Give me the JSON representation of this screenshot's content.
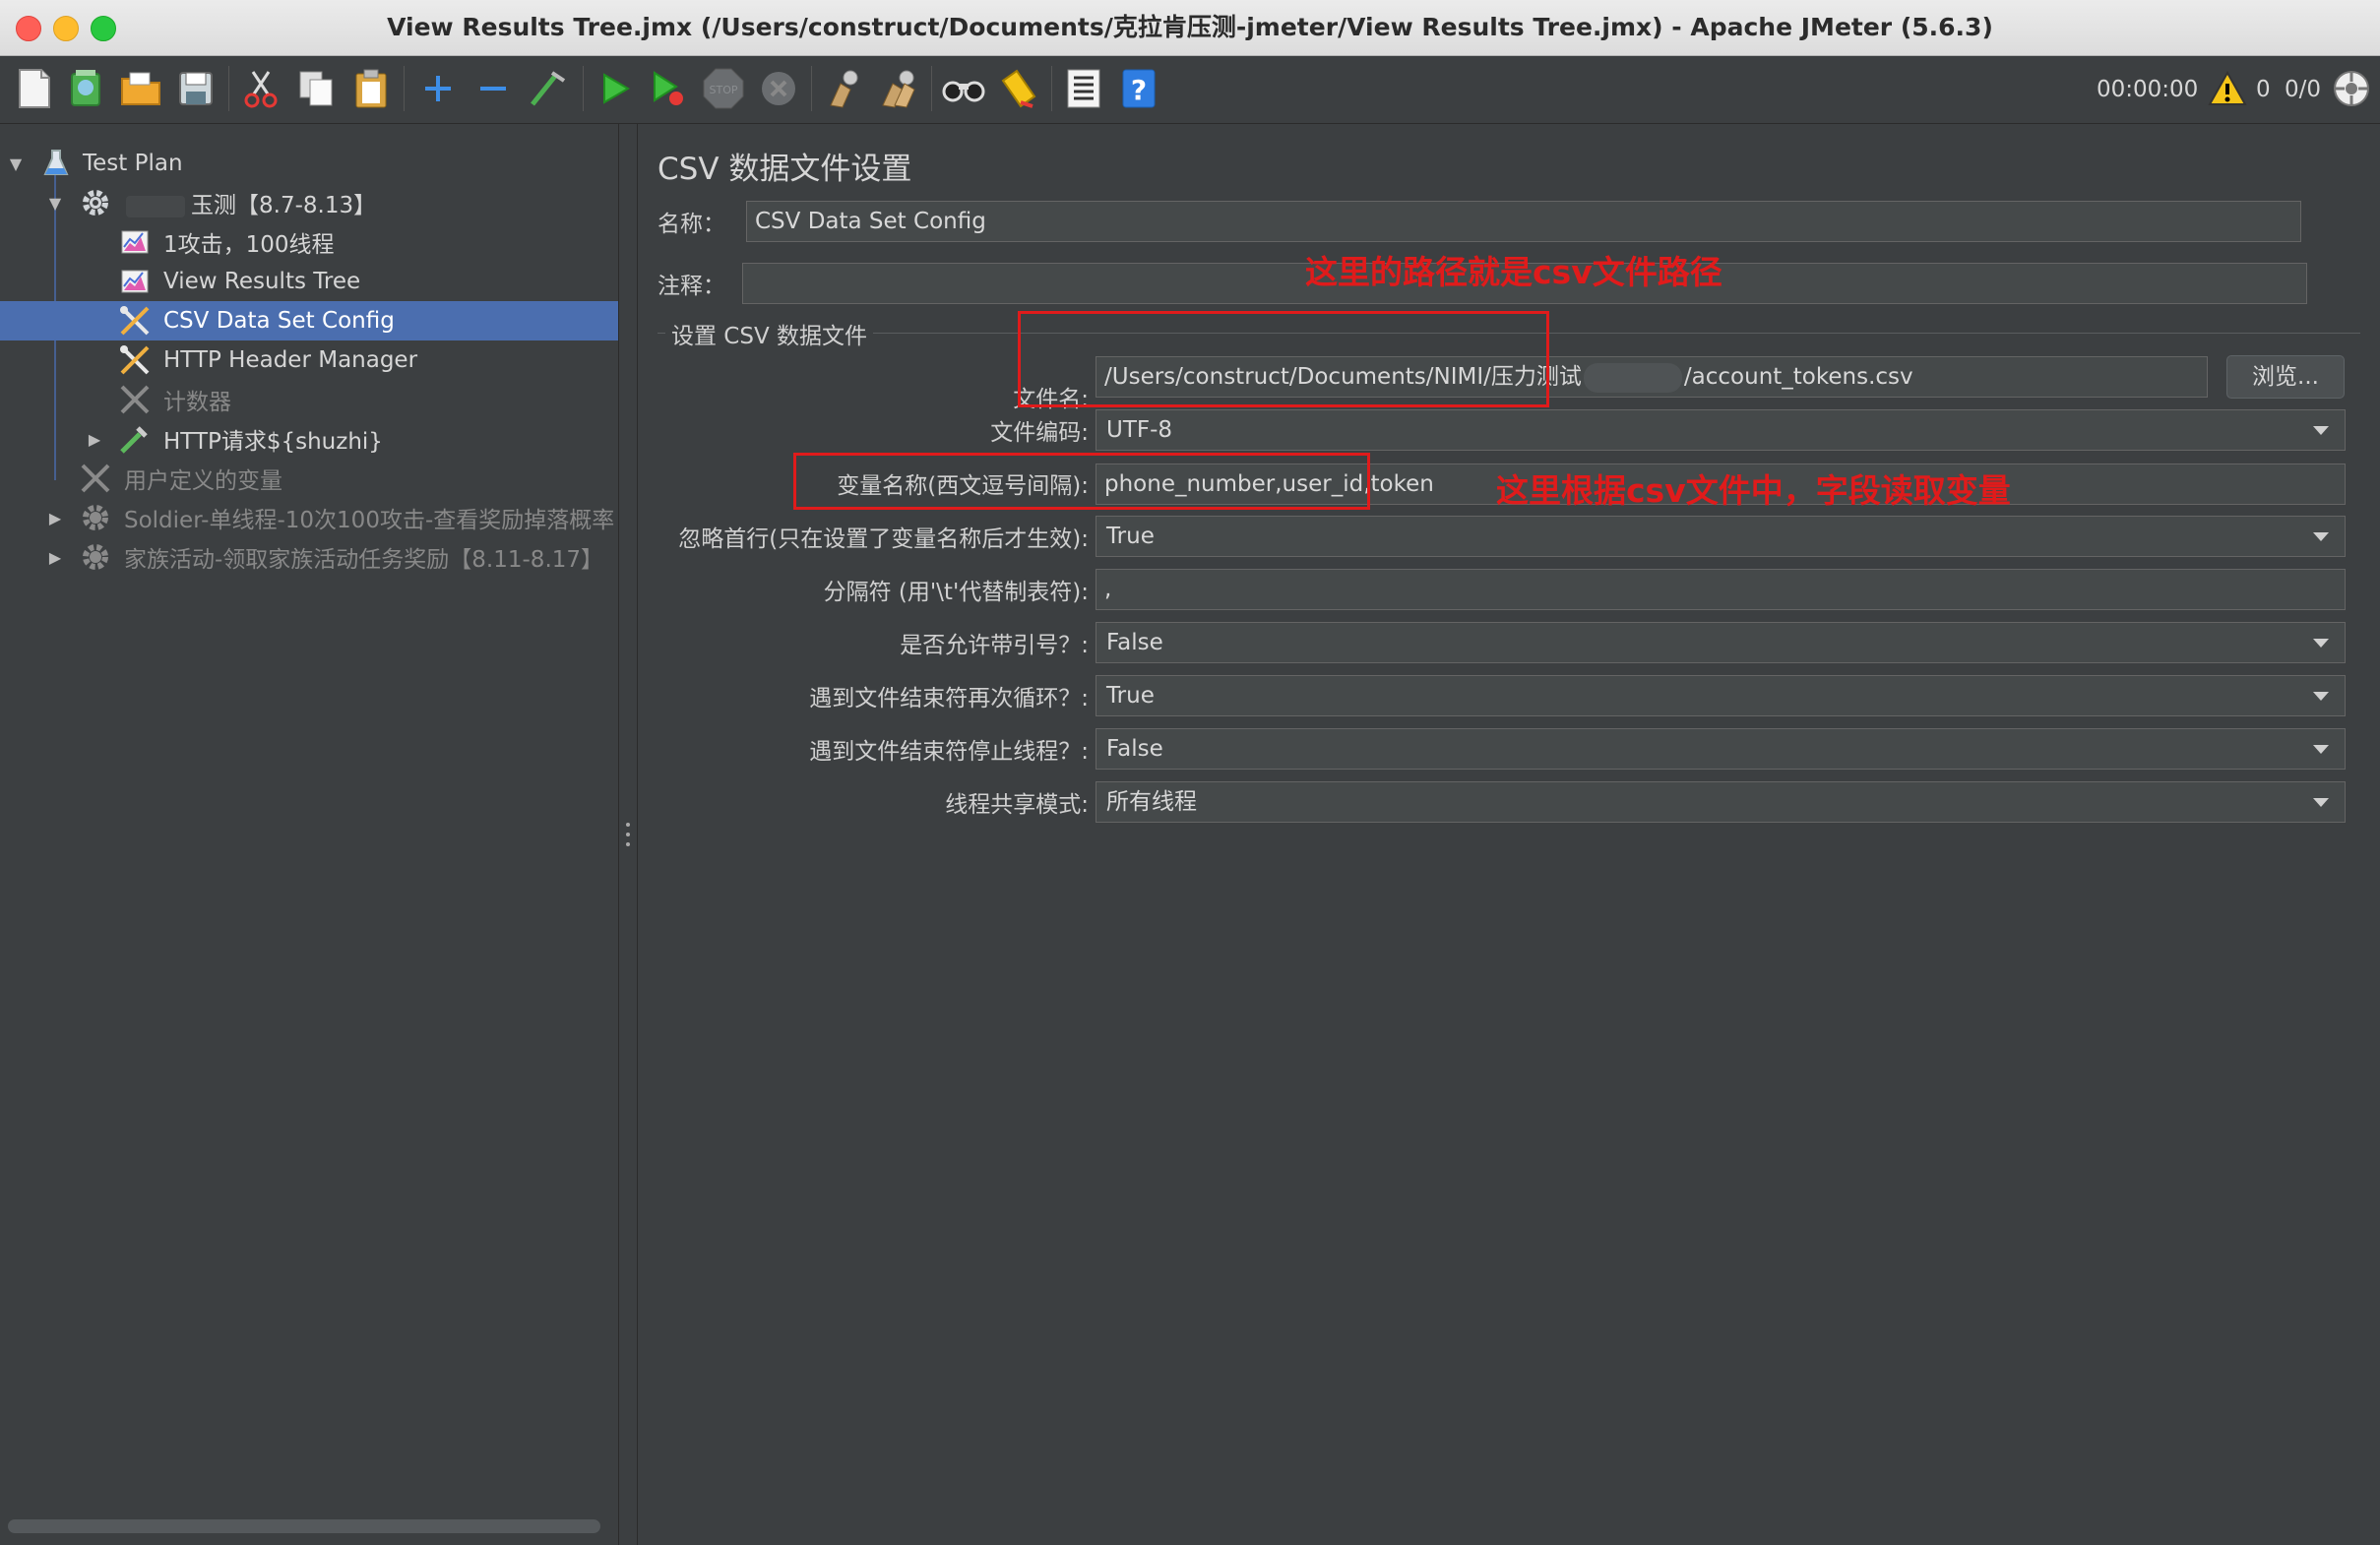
{
  "window": {
    "title": "View Results Tree.jmx (/Users/construct/Documents/克拉肯压测-jmeter/View Results Tree.jmx) - Apache JMeter (5.6.3)"
  },
  "toolbar": {
    "icons": [
      "new-icon",
      "templates-icon",
      "open-icon",
      "save-icon",
      "cut-icon",
      "copy-icon",
      "paste-icon",
      "expand-icon",
      "collapse-icon",
      "toggle-icon",
      "start-icon",
      "start-no-pause-icon",
      "stop-icon",
      "shutdown-icon",
      "clear-icon",
      "clear-all-icon",
      "search-icon",
      "reset-search-icon",
      "function-helper-icon",
      "help-icon"
    ],
    "timer": "00:00:00",
    "warning_count": "0",
    "threads": "0/0"
  },
  "tree": {
    "items": [
      {
        "label": "Test Plan"
      },
      {
        "label": "玉测【8.7-8.13】"
      },
      {
        "label": "1攻击，100线程"
      },
      {
        "label": "View Results Tree"
      },
      {
        "label": "CSV Data Set Config"
      },
      {
        "label": "HTTP Header Manager"
      },
      {
        "label": "计数器"
      },
      {
        "label": "HTTP请求${shuzhi}"
      },
      {
        "label": "用户定义的变量"
      },
      {
        "label": "Soldier-单线程-10次100攻击-查看奖励掉落概率"
      },
      {
        "label": "家族活动-领取家族活动任务奖励【8.11-8.17】"
      }
    ]
  },
  "panel": {
    "title": "CSV 数据文件设置",
    "name_label": "名称：",
    "name_value": "CSV Data Set Config",
    "comment_label": "注释：",
    "comment_value": "",
    "group_title": "设置 CSV 数据文件",
    "filename_label": "文件名:",
    "filename_prefix": "/Users/construct/Documents/NIMI/压力测试",
    "filename_suffix": "/account_tokens.csv",
    "browse_label": "浏览...",
    "encoding_label": "文件编码:",
    "encoding_value": "UTF-8",
    "varnames_label": "变量名称(西文逗号间隔):",
    "varnames_value": "phone_number,user_id,token",
    "ignore_first_label": "忽略首行(只在设置了变量名称后才生效):",
    "ignore_first_value": "True",
    "delimiter_label": "分隔符 (用'\\t'代替制表符):",
    "delimiter_value": ",",
    "quoted_label": "是否允许带引号？:",
    "quoted_value": "False",
    "recycle_label": "遇到文件结束符再次循环？:",
    "recycle_value": "True",
    "stop_thread_label": "遇到文件结束符停止线程？:",
    "stop_thread_value": "False",
    "share_mode_label": "线程共享模式:",
    "share_mode_value": "所有线程"
  },
  "annotations": {
    "path_note": "这里的路径就是csv文件路径",
    "var_note": "这里根据csv文件中，字段读取变量",
    "color": "#e01b1b"
  }
}
